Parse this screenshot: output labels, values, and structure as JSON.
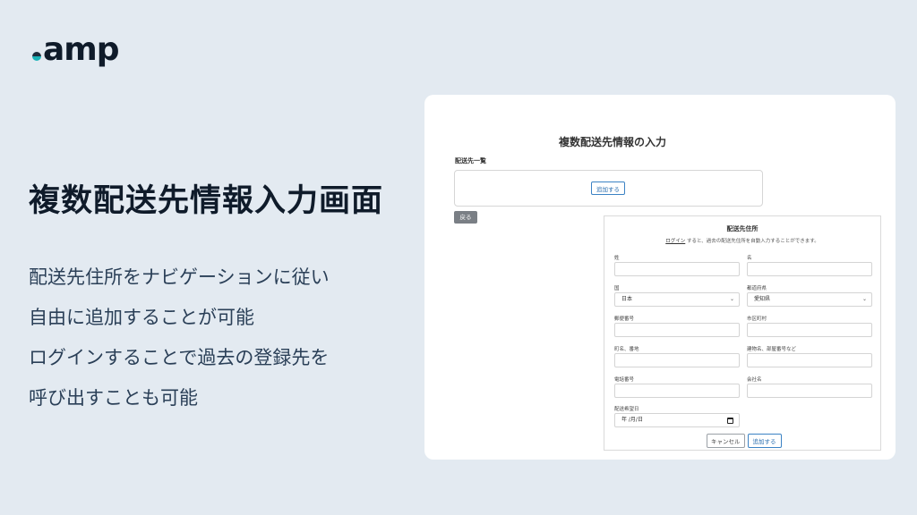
{
  "brand": {
    "logo_text": "amp",
    "colors": {
      "dark": "#0f1b2a",
      "teal": "#1bb3b8",
      "background": "#e3eaf1"
    }
  },
  "headline": "複数配送先情報入力画面",
  "description": [
    "配送先住所をナビゲーションに従い",
    "自由に追加することが可能",
    "ログインすることで過去の登録先を",
    "呼び出すことも可能"
  ],
  "form": {
    "title": "複数配送先情報の入力",
    "list_label": "配送先一覧",
    "list_add_button": "追加する",
    "back_button": "戻る",
    "panel": {
      "title": "配送先住所",
      "note_link": "ログイン",
      "note_text": "すると、過去の配送先住所を自動入力することができます。",
      "fields": {
        "last_name": {
          "label": "姓",
          "value": ""
        },
        "first_name": {
          "label": "名",
          "value": ""
        },
        "country": {
          "label": "国",
          "value": "日本"
        },
        "prefecture": {
          "label": "都道府県",
          "value": "愛知県"
        },
        "postal_code": {
          "label": "郵便番号",
          "value": ""
        },
        "city": {
          "label": "市区町村",
          "value": ""
        },
        "town": {
          "label": "町名、番地",
          "value": ""
        },
        "building": {
          "label": "建物名、部屋番号など",
          "value": ""
        },
        "phone": {
          "label": "電話番号",
          "value": ""
        },
        "company": {
          "label": "会社名",
          "value": ""
        },
        "delivery_date": {
          "label": "配送希望日",
          "value": "年 /月/日"
        }
      },
      "cancel_button": "キャンセル",
      "submit_button": "追加する"
    }
  }
}
